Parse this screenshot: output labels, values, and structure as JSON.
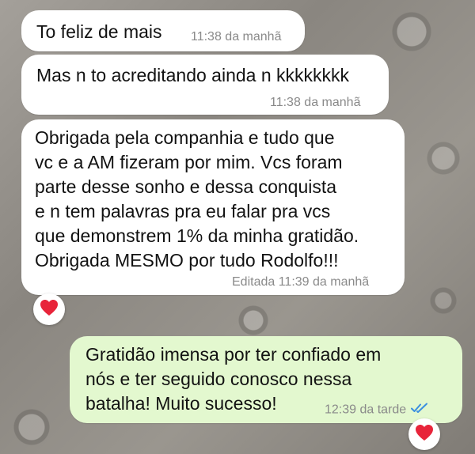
{
  "messages": [
    {
      "direction": "incoming",
      "text": "To feliz de mais",
      "time": "11:38 da manhã"
    },
    {
      "direction": "incoming",
      "text": "Mas n to acreditando ainda n kkkkkkkk",
      "time": "11:38 da manhã"
    },
    {
      "direction": "incoming",
      "text": "Obrigada pela companhia e tudo que\nvc e a AM fizeram por mim. Vcs foram\nparte desse sonho e dessa conquista\ne n tem palavras pra eu falar pra vcs\nque demonstrem 1% da minha gratidão.\nObrigada MESMO por tudo Rodolfo!!!",
      "time": "Editada 11:39 da manhã",
      "reaction": "heart-icon"
    },
    {
      "direction": "outgoing",
      "text": "Gratidão imensa por ter confiado em\nnós e ter seguido conosco nessa\nbatalha! Muito sucesso!",
      "time": "12:39 da tarde",
      "status_icon": "double-check-icon",
      "reaction": "heart-icon"
    }
  ],
  "colors": {
    "incoming_bubble": "#ffffff",
    "outgoing_bubble": "#e3f8cf",
    "read_tick": "#3b8fe0",
    "heart": "#e8243a"
  }
}
